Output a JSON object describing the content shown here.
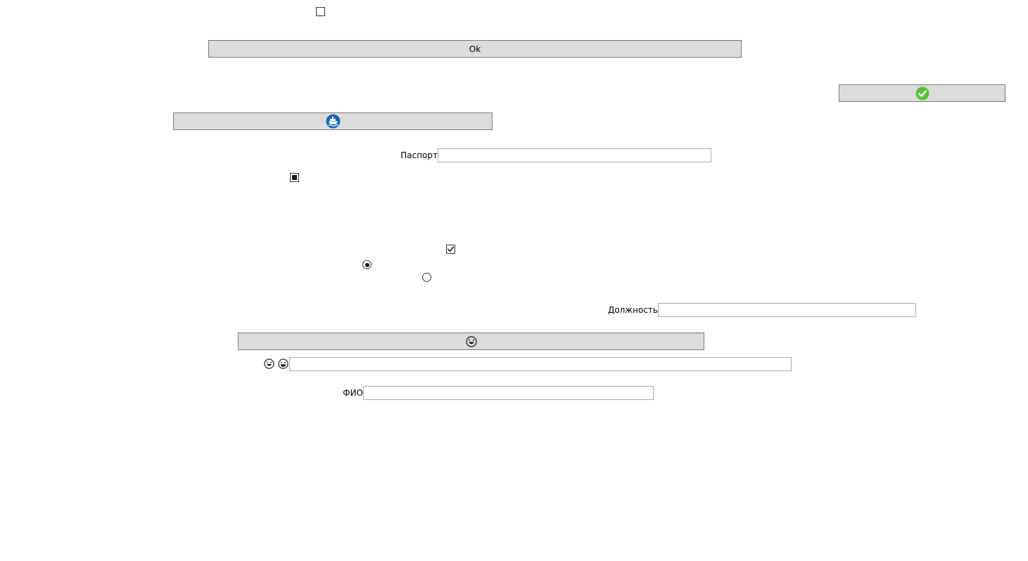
{
  "checkboxes": {
    "top_checkbox": {
      "state": "unchecked"
    },
    "middle_checkbox": {
      "state": "indeterminate"
    },
    "lower_checkbox": {
      "state": "checked"
    }
  },
  "radios": {
    "first": {
      "state": "checked"
    },
    "second": {
      "state": "unchecked"
    }
  },
  "buttons": {
    "ok_label": "Ok",
    "check_icon": "check-circle-icon",
    "ship_icon": "ship-icon",
    "emoji_button_icon": "laughing-emoji-icon"
  },
  "fields": {
    "passport_label": "Паспорт",
    "passport_value": "",
    "position_label": "Должность",
    "position_value": "",
    "emoji_field_icons": [
      "laughing-emoji-icon",
      "grinning-emoji-icon"
    ],
    "emoji_field_value": "",
    "fio_label": "ФИО",
    "fio_value": ""
  },
  "colors": {
    "check_green": "#5bbf3c",
    "ship_blue": "#1565c0",
    "button_bg": "#dcdcdc"
  }
}
